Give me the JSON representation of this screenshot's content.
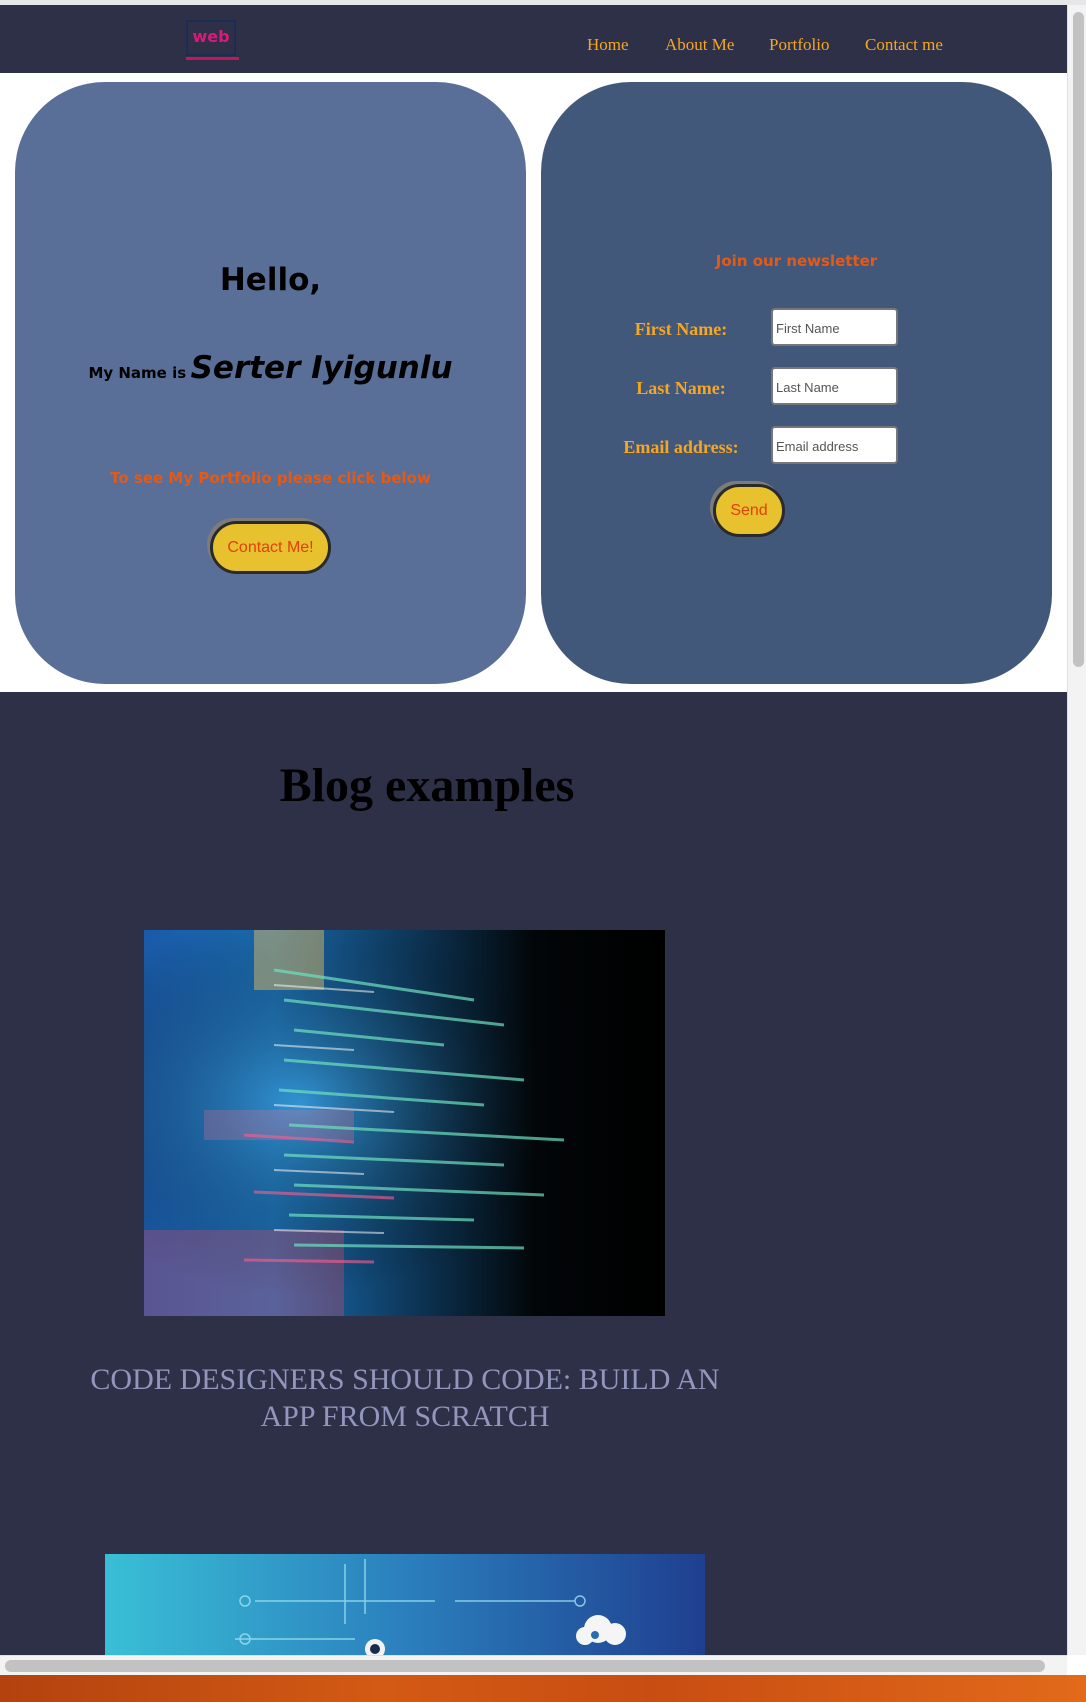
{
  "header": {
    "logo_text": "web",
    "nav": [
      "Home",
      "About Me",
      "Portfolio",
      "Contact me"
    ]
  },
  "hero": {
    "greeting": "Hello,",
    "name_prefix": "My Name is",
    "name": "Serter Iyigunlu",
    "portfolio_prompt": "To see My Portfolio please click below",
    "contact_button": "Contact Me!"
  },
  "newsletter": {
    "title": "Join our newsletter",
    "fields": [
      {
        "label": "First Name:",
        "placeholder": "First Name"
      },
      {
        "label": "Last Name:",
        "placeholder": "Last Name"
      },
      {
        "label": "Email address:",
        "placeholder": "Email address"
      }
    ],
    "send_button": "Send"
  },
  "blog": {
    "title": "Blog examples",
    "posts": [
      {
        "title": "CODE DESIGNERS SHOULD CODE: BUILD AN APP FROM SCRATCH"
      }
    ]
  },
  "colors": {
    "nav_bg": "#2e3048",
    "accent_orange": "#f5a623",
    "button_yellow": "#e7c12e",
    "card_left": "#5a6f98",
    "card_right": "#42587b"
  }
}
